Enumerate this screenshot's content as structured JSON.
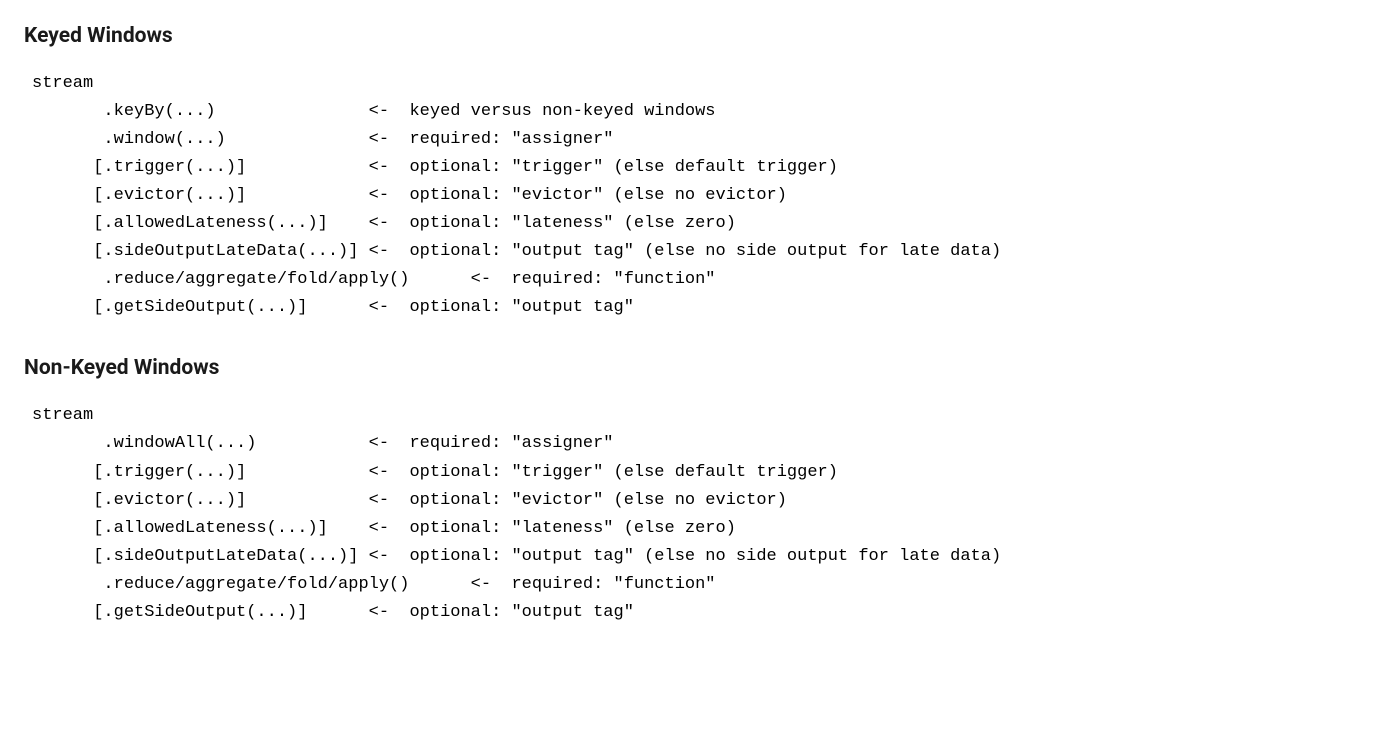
{
  "section1": {
    "title": "Keyed Windows",
    "code": "stream\n       .keyBy(...)               <-  keyed versus non-keyed windows\n       .window(...)              <-  required: \"assigner\"\n      [.trigger(...)]            <-  optional: \"trigger\" (else default trigger)\n      [.evictor(...)]            <-  optional: \"evictor\" (else no evictor)\n      [.allowedLateness(...)]    <-  optional: \"lateness\" (else zero)\n      [.sideOutputLateData(...)] <-  optional: \"output tag\" (else no side output for late data)\n       .reduce/aggregate/fold/apply()      <-  required: \"function\"\n      [.getSideOutput(...)]      <-  optional: \"output tag\""
  },
  "section2": {
    "title": "Non-Keyed Windows",
    "code": "stream\n       .windowAll(...)           <-  required: \"assigner\"\n      [.trigger(...)]            <-  optional: \"trigger\" (else default trigger)\n      [.evictor(...)]            <-  optional: \"evictor\" (else no evictor)\n      [.allowedLateness(...)]    <-  optional: \"lateness\" (else zero)\n      [.sideOutputLateData(...)] <-  optional: \"output tag\" (else no side output for late data)\n       .reduce/aggregate/fold/apply()      <-  required: \"function\"\n      [.getSideOutput(...)]      <-  optional: \"output tag\""
  }
}
